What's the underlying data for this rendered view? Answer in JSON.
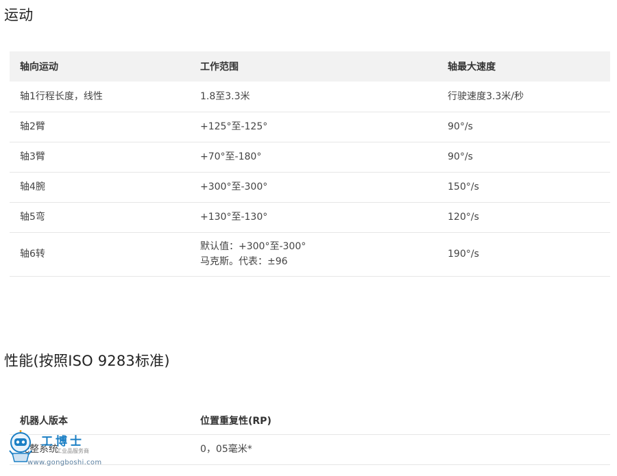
{
  "motion": {
    "title": "运动",
    "headers": [
      "轴向运动",
      "工作范围",
      "轴最大速度"
    ],
    "rows": [
      {
        "axis": "轴1行程长度，线性",
        "range": [
          "1.8至3.3米"
        ],
        "speed": "行驶速度3.3米/秒"
      },
      {
        "axis": "轴2臂",
        "range": [
          "+125°至-125°"
        ],
        "speed": "90°/s"
      },
      {
        "axis": "轴3臂",
        "range": [
          "+70°至-180°"
        ],
        "speed": "90°/s"
      },
      {
        "axis": "轴4腕",
        "range": [
          "+300°至-300°"
        ],
        "speed": "150°/s"
      },
      {
        "axis": "轴5弯",
        "range": [
          "+130°至-130°"
        ],
        "speed": "120°/s"
      },
      {
        "axis": "轴6转",
        "range": [
          "默认值：+300°至-300°",
          "马克斯。代表：±96"
        ],
        "speed": "190°/s"
      }
    ]
  },
  "performance": {
    "title": "性能(按照ISO 9283标准)",
    "headers": [
      "机器人版本",
      "位置重复性(RP)"
    ],
    "rows": [
      {
        "version": "完整系统",
        "rp": "0，05毫米*"
      }
    ]
  },
  "watermark": {
    "brand": "工博士",
    "tagline": "工业品服务商",
    "url": "www.gongboshi.com",
    "icon": "robot-mascot-icon",
    "accent": "#1b7fc4"
  }
}
